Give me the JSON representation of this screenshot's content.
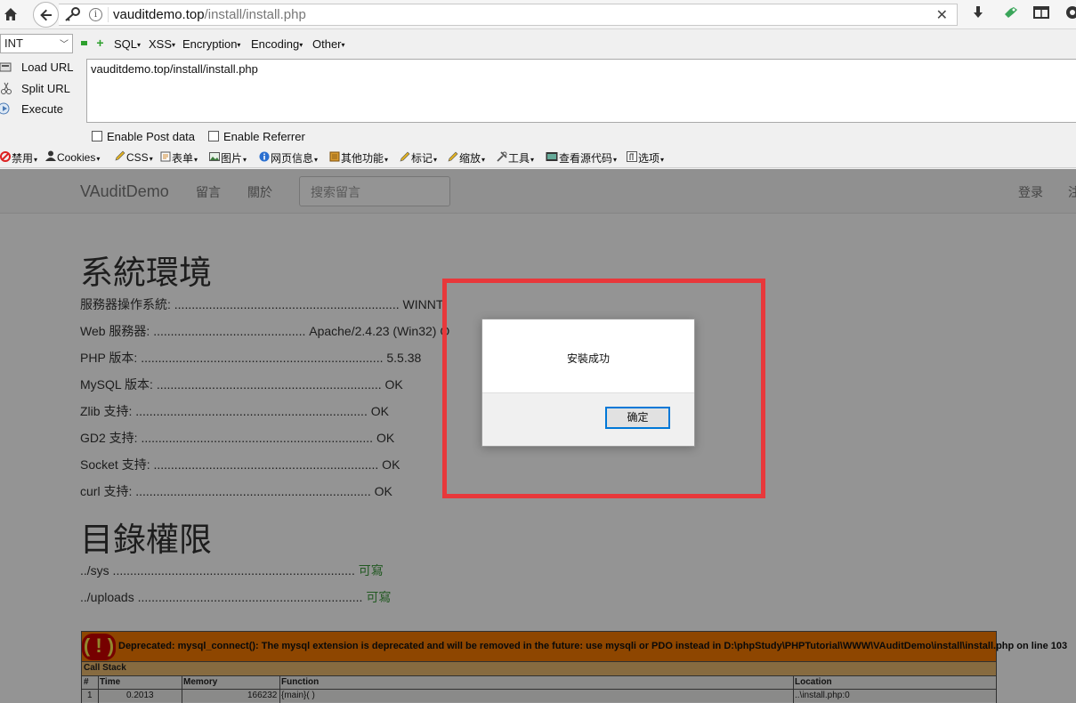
{
  "browser": {
    "url_host": "vauditdemo.top",
    "url_path": "/install/install.php"
  },
  "hackbar": {
    "select_value": "INT",
    "menus": [
      "SQL",
      "XSS",
      "Encryption",
      "Encoding",
      "Other"
    ],
    "load_url": "Load URL",
    "split_url": "Split URL",
    "execute": "Execute",
    "textarea": "vauditdemo.top/install/install.php",
    "enable_post": "Enable Post data",
    "enable_referrer": "Enable Referrer"
  },
  "webdev": {
    "items": [
      "禁用",
      "Cookies",
      "CSS",
      "表单",
      "图片",
      "网页信息",
      "其他功能",
      "标记",
      "缩放",
      "工具",
      "查看源代码",
      "选项"
    ]
  },
  "site": {
    "brand": "VAuditDemo",
    "nav_links": [
      "留言",
      "關於"
    ],
    "search_placeholder": "搜索留言",
    "login": "登录",
    "register": "注"
  },
  "env": {
    "title": "系統環境",
    "rows": [
      "服務器操作系統: ................................................................. WINNT",
      "Web 服務器: ............................................ Apache/2.4.23 (Win32) O",
      "PHP 版本: ...................................................................... 5.5.38",
      "MySQL 版本: ................................................................. OK",
      "Zlib 支持: ................................................................... OK",
      "GD2 支持: ................................................................... OK",
      "Socket 支持: ................................................................. OK",
      "curl 支持: .................................................................... OK"
    ]
  },
  "perm": {
    "title": "目錄權限",
    "rows": [
      {
        "path": "../sys ...................................................................... ",
        "status": "可寫"
      },
      {
        "path": "../uploads ................................................................. ",
        "status": "可寫"
      }
    ]
  },
  "xdebug": {
    "bang": "( ! )",
    "message": "Deprecated: mysql_connect(): The mysql extension is deprecated and will be removed in the future: use mysqli or PDO instead in D:\\phpStudy\\PHPTutorial\\WWW\\VAuditDemo\\install\\install.php on line 103",
    "call_stack": "Call Stack",
    "headers": {
      "num": "#",
      "time": "Time",
      "memory": "Memory",
      "function": "Function",
      "location": "Location"
    },
    "row": {
      "num": "1",
      "time": "0.2013",
      "memory": "166232",
      "function": "{main}( )",
      "location": "..\\install.php:0"
    }
  },
  "dialog": {
    "message": "安裝成功",
    "ok": "确定"
  },
  "colors": {
    "highlight": "#e8383b",
    "xdebug_orange": "#f57900",
    "writable_green": "#3c9a3c"
  }
}
